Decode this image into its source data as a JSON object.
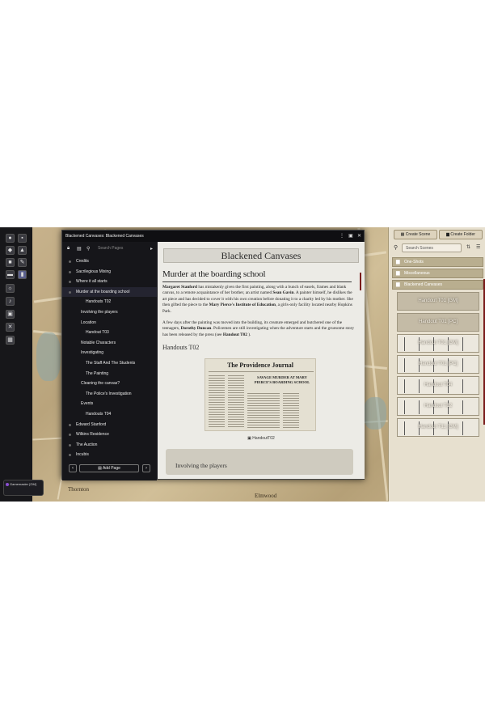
{
  "journal": {
    "title": "Blackened Canvases: Blackened Canvases",
    "search_placeholder": "Search Pages",
    "toc": [
      {
        "label": "Credits",
        "level": 0
      },
      {
        "label": "Sacrilegious Mixing",
        "level": 0
      },
      {
        "label": "Where it all starts",
        "level": 0
      },
      {
        "label": "Murder at the boarding school",
        "level": 0,
        "selected": true
      },
      {
        "label": "Handouts T02",
        "level": 2
      },
      {
        "label": "Involving the players",
        "level": 1
      },
      {
        "label": "Location",
        "level": 1
      },
      {
        "label": "Handout T03",
        "level": 2
      },
      {
        "label": "Notable Characters",
        "level": 1
      },
      {
        "label": "Investigating",
        "level": 1
      },
      {
        "label": "The Staff And The Students",
        "level": 2
      },
      {
        "label": "The Painting",
        "level": 2
      },
      {
        "label": "Cleaning the canvas?",
        "level": 1
      },
      {
        "label": "The Police's Investigation",
        "level": 2
      },
      {
        "label": "Events",
        "level": 1
      },
      {
        "label": "Handouts T04",
        "level": 2
      },
      {
        "label": "Edward Stanford",
        "level": 0
      },
      {
        "label": "Wilkins Residence",
        "level": 0
      },
      {
        "label": "The Auction",
        "level": 0
      },
      {
        "label": "Incubis",
        "level": 0
      }
    ],
    "add_page_label": "Add Page",
    "page": {
      "banner": "Blackened Canvases",
      "heading": "Murder at the boarding school",
      "p1_name": "Margaret Stanford",
      "p1_a": " has mistakenly given the first painting, along with a bunch of easels, frames and blank canvas, to a remote acquaintance of her brother, an artist named ",
      "p1_name2": "Sean Gavin",
      "p1_b": ". A painter himself, he dislikes the art piece and has decided to cover it with his own creation before donating it to a charity led by his mother. She then gifted the piece to the ",
      "p1_name3": "Mary Pierce's Institute of Education",
      "p1_c": ", a girls-only facility located nearby Hopkins Park.",
      "p2_a": "A few days after the painting was moved into the building, its creature emerged and butchered one of the teenagers, ",
      "p2_name": "Dorothy Duncan",
      "p2_b": ". Policemen are still investigating when the adventure starts and the gruesome story has been released by the press (see ",
      "p2_link": "Handout T02",
      "p2_c": " ).",
      "subheading": "Handouts T02",
      "newspaper_name": "The Providence Journal",
      "newspaper_headline": "SAVAGE MURDER AT MARY PIERCE'S BOARDING SCHOOL",
      "caption": "HandoutT02",
      "next_heading": "Involving the players"
    }
  },
  "map": {
    "labels": [
      "Thornton",
      "Elmwood"
    ]
  },
  "players": {
    "label": "Gamemaster [GM]"
  },
  "scenes": {
    "create_scene": "Create Scene",
    "create_folder": "Create Folder",
    "search_placeholder": "Search Scenes",
    "folders": [
      "One-Shots",
      "Miscellaneous",
      "Blackened Canvases"
    ],
    "items": [
      "Handout T01 [GM]",
      "Handout T01 [PC]",
      "Handout T01 [GM]",
      "Handout T01 [PC]",
      "Handout T04",
      "Handout T12",
      "Handout T11 [GM]"
    ]
  },
  "colors": {
    "accent": "#7a1a1a",
    "panel": "#16161a",
    "page": "#ecebe6"
  }
}
